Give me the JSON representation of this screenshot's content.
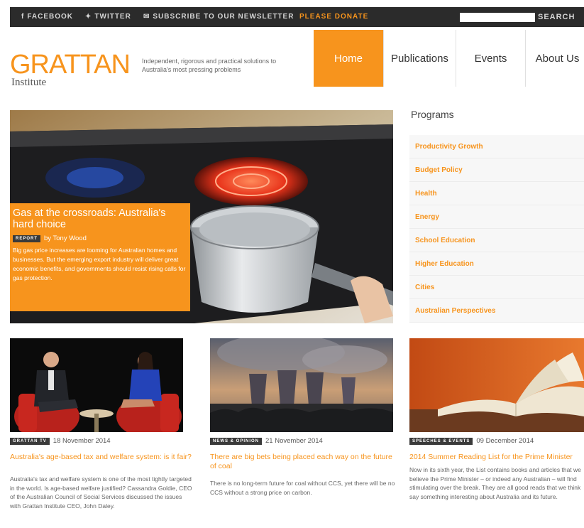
{
  "topbar": {
    "facebook": "FACEBOOK",
    "twitter": "TWITTER",
    "newsletter": "SUBSCRIBE TO OUR NEWSLETTER",
    "donate": "PLEASE DONATE",
    "search_button": "SEARCH",
    "search_value": ""
  },
  "header": {
    "logo": "GRATTAN",
    "logo_sub": "Institute",
    "tagline": "Independent, rigorous and practical solutions to Australia's most pressing problems"
  },
  "nav": [
    "Home",
    "Publications",
    "Events",
    "About Us"
  ],
  "hero": {
    "title": "Gas at the crossroads: Australia's hard choice",
    "tag": "REPORT",
    "byline": "by Tony Wood",
    "description": "Big gas price increases are looming for Australian homes and businesses. But the emerging export industry will deliver great economic benefits, and governments should resist rising calls for gas protection."
  },
  "programs": {
    "heading": "Programs",
    "items": [
      "Productivity Growth",
      "Budget Policy",
      "Health",
      "Energy",
      "School Education",
      "Higher Education",
      "Cities",
      "Australian Perspectives"
    ]
  },
  "articles": [
    {
      "tag": "GRATTAN TV",
      "date": "18 November 2014",
      "title": "Australia's age-based tax and welfare system: is it fair?",
      "description": "Australia's tax and welfare system is one of the most tightly targeted in the world. Is age-based welfare justified? Cassandra Goldie, CEO of the Australian Council of Social Services discussed the issues with Grattan Institute CEO, John Daley."
    },
    {
      "tag": "NEWS & OPINION",
      "date": "21 November 2014",
      "title": "There are big bets being placed each way on the future of coal",
      "description": "There is no long-term future for coal without CCS, yet there will be no CCS without a strong price on carbon."
    },
    {
      "tag": "SPEECHES & EVENTS",
      "date": "09 December 2014",
      "title": "2014 Summer Reading List for the Prime Minister",
      "description": "Now in its sixth year, the List contains books and articles that we believe the Prime Minister – or indeed any Australian – will find stimulating over the break. They are all good reads that we think say something interesting about Australia and its future."
    }
  ],
  "colors": {
    "accent": "#f7941d",
    "topbar": "#2b2b2b",
    "tag": "#3a3a3a"
  }
}
